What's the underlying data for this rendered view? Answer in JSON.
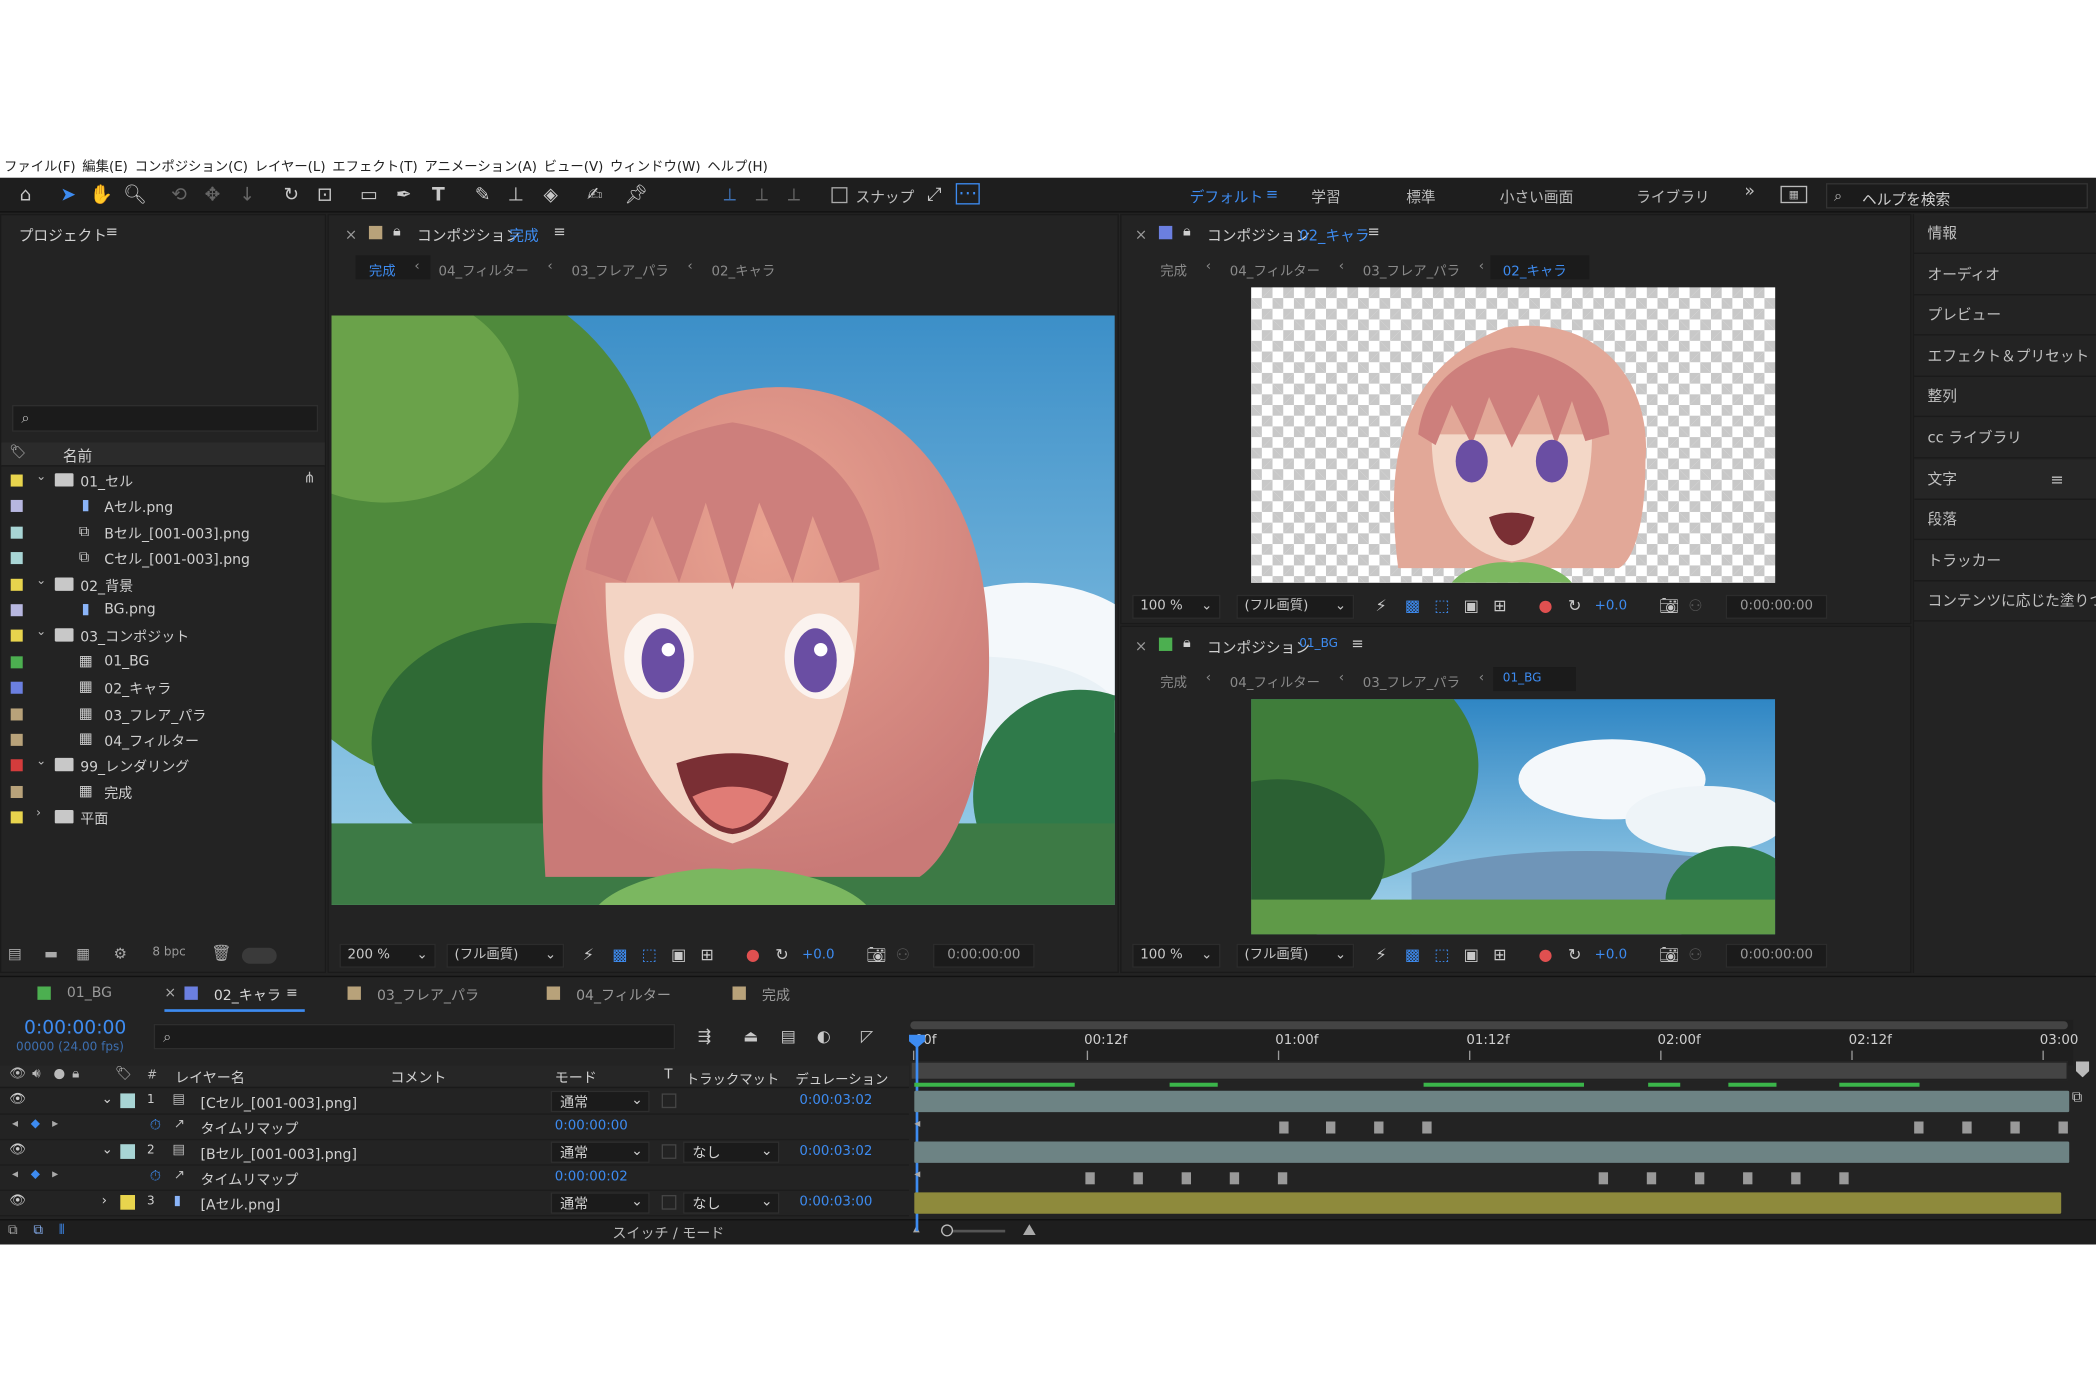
{
  "menu": [
    "ファイル(F)",
    "編集(E)",
    "コンポジション(C)",
    "レイヤー(L)",
    "エフェクト(T)",
    "アニメーション(A)",
    "ビュー(V)",
    "ウィンドウ(W)",
    "ヘルプ(H)"
  ],
  "toolbar": {
    "snap_label": "スナップ",
    "workspaces": [
      "デフォルト",
      "学習",
      "標準",
      "小さい画面",
      "ライブラリ"
    ],
    "search_placeholder": "ヘルプを検索"
  },
  "project": {
    "title": "プロジェクト",
    "column_name": "名前",
    "bpc": "8 bpc",
    "items": [
      {
        "name": "01_セル",
        "type": "folder",
        "color": "#e8d44d",
        "level": 0,
        "open": true
      },
      {
        "name": "Aセル.png",
        "type": "image",
        "color": "#b7b7e0",
        "level": 1
      },
      {
        "name": "Bセル_[001-003].png",
        "type": "sequence",
        "color": "#a8d5d5",
        "level": 1
      },
      {
        "name": "Cセル_[001-003].png",
        "type": "sequence",
        "color": "#a8d5d5",
        "level": 1
      },
      {
        "name": "02_背景",
        "type": "folder",
        "color": "#e8d44d",
        "level": 0,
        "open": true
      },
      {
        "name": "BG.png",
        "type": "image",
        "color": "#b7b7e0",
        "level": 1
      },
      {
        "name": "03_コンポジット",
        "type": "folder",
        "color": "#e8d44d",
        "level": 0,
        "open": true
      },
      {
        "name": "01_BG",
        "type": "comp",
        "color": "#4caf50",
        "level": 1
      },
      {
        "name": "02_キャラ",
        "type": "comp",
        "color": "#6b7fe0",
        "level": 1
      },
      {
        "name": "03_フレア_パラ",
        "type": "comp",
        "color": "#b8a27a",
        "level": 1
      },
      {
        "name": "04_フィルター",
        "type": "comp",
        "color": "#b8a27a",
        "level": 1
      },
      {
        "name": "99_レンダリング",
        "type": "folder",
        "color": "#d43c3c",
        "level": 0,
        "open": true
      },
      {
        "name": "完成",
        "type": "comp",
        "color": "#b8a27a",
        "level": 1
      },
      {
        "name": "平面",
        "type": "folder",
        "color": "#e8d44d",
        "level": 0,
        "open": false
      }
    ]
  },
  "comp_main": {
    "title_prefix": "コンポジション",
    "title_name": "完成",
    "crumbs": [
      "完成",
      "04_フィルター",
      "03_フレア_パラ",
      "02_キャラ"
    ],
    "zoom": "200 %",
    "quality": "(フル画質)",
    "exposure": "+0.0",
    "time": "0:00:00:00"
  },
  "comp_chara": {
    "title_prefix": "コンポジション",
    "title_name": "02_キャラ",
    "crumbs": [
      "完成",
      "04_フィルター",
      "03_フレア_パラ",
      "02_キャラ"
    ],
    "zoom": "100 %",
    "quality": "(フル画質)",
    "exposure": "+0.0",
    "time": "0:00:00:00"
  },
  "comp_bg": {
    "title_prefix": "コンポジション",
    "title_name": "01_BG",
    "crumbs": [
      "完成",
      "04_フィルター",
      "03_フレア_パラ",
      "01_BG"
    ],
    "zoom": "100 %",
    "quality": "(フル画質)",
    "exposure": "+0.0",
    "time": "0:00:00:00"
  },
  "right_panels": [
    "情報",
    "オーディオ",
    "プレビュー",
    "エフェクト＆プリセット",
    "整列",
    "cc ライブラリ",
    "文字",
    "段落",
    "トラッカー",
    "コンテンツに応じた塗りつ"
  ],
  "timeline": {
    "tabs": [
      {
        "label": "01_BG",
        "color": "#4caf50"
      },
      {
        "label": "02_キャラ",
        "color": "#6b7fe0",
        "active": true
      },
      {
        "label": "03_フレア_パラ",
        "color": "#b8a27a"
      },
      {
        "label": "04_フィルター",
        "color": "#b8a27a"
      },
      {
        "label": "完成",
        "color": "#b8a27a"
      }
    ],
    "current_time": "0:00:00:00",
    "fps_info": "00000 (24.00 fps)",
    "headers": {
      "num": "#",
      "layer_name": "レイヤー名",
      "comment": "コメント",
      "mode": "モード",
      "t": "T",
      "track_matte": "トラックマット",
      "duration": "デュレーション"
    },
    "ruler": [
      ":00f",
      "00:12f",
      "01:00f",
      "01:12f",
      "02:00f",
      "02:12f",
      "03:00"
    ],
    "layers": [
      {
        "num": "1",
        "name": "[Cセル_[001-003].png]",
        "color": "#a8d5d5",
        "mode": "通常",
        "matte": "",
        "duration": "0:00:03:02",
        "sub": "タイムリマップ",
        "sub_value": "0:00:00:00"
      },
      {
        "num": "2",
        "name": "[Bセル_[001-003].png]",
        "color": "#a8d5d5",
        "mode": "通常",
        "matte": "なし",
        "duration": "0:00:03:02",
        "sub": "タイムリマップ",
        "sub_value": "0:00:00:02"
      },
      {
        "num": "3",
        "name": "[Aセル.png]",
        "color": "#e8d44d",
        "mode": "通常",
        "matte": "なし",
        "duration": "0:00:03:00"
      }
    ],
    "footer_label": "スイッチ / モード"
  }
}
